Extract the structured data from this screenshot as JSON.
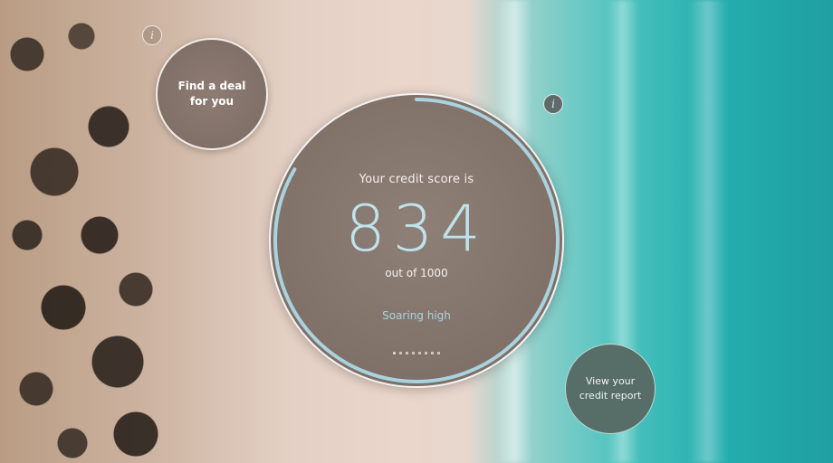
{
  "credit": {
    "label": "Your credit score is",
    "score": "834",
    "max_text": "out of 1000",
    "status": "Soaring high",
    "score_fraction": 0.834
  },
  "carousel": {
    "total": 8,
    "active_index": 0
  },
  "deal": {
    "label": "Find a deal for you"
  },
  "report": {
    "label": "View your credit report"
  },
  "info_icons": [
    "info-icon",
    "info-icon"
  ],
  "colors": {
    "accent_ring": "#a9d3df",
    "circle_fill": "#7f7068",
    "report_fill": "#566d68"
  }
}
